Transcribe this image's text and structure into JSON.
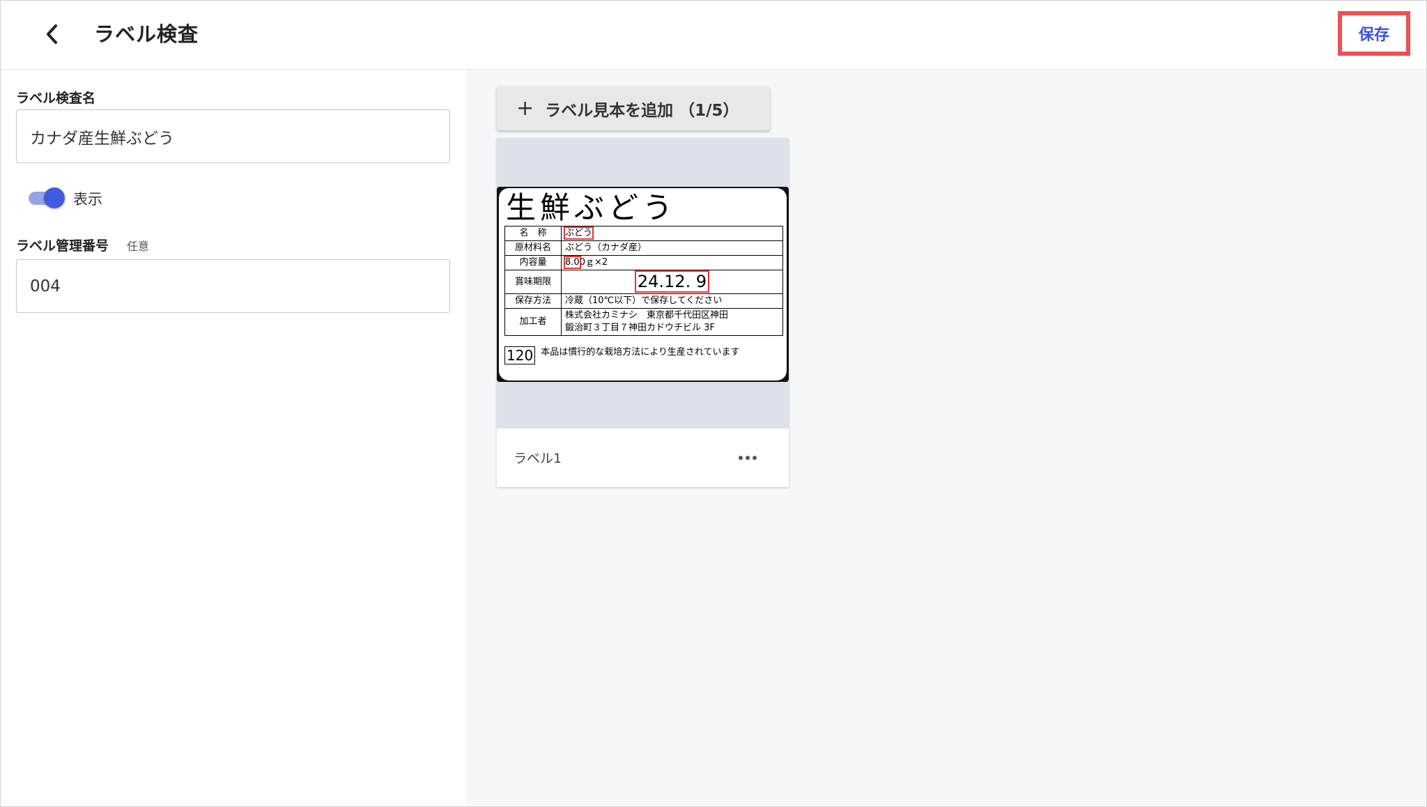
{
  "header": {
    "title": "ラベル検査",
    "save_label": "保存"
  },
  "form": {
    "name_label": "ラベル検査名",
    "name_value": "カナダ産生鮮ぶどう",
    "display_toggle_label": "表示",
    "display_toggle_on": true,
    "number_label": "ラベル管理番号",
    "number_optional": "任意",
    "number_value": "004"
  },
  "samples": {
    "add_button_label": "ラベル見本を追加 （1/5）",
    "cards": [
      {
        "name": "ラベル1",
        "label_image": {
          "heading": "生鮮ぶどう",
          "rows": [
            {
              "key": "名　称",
              "value": "ぶどう"
            },
            {
              "key": "原材料名",
              "value": "ぶどう（カナダ産）"
            },
            {
              "key": "内容量",
              "value_highlight": "8.0",
              "value_rest": "0ｇ×2"
            },
            {
              "key": "賞味期限",
              "value": "24.12. 9"
            },
            {
              "key": "保存方法",
              "value": "冷蔵（10℃以下）で保存してください"
            },
            {
              "key": "加工者",
              "value_line1": "株式会社カミナシ　東京都千代田区神田",
              "value_line2": "鍛治町３丁目７神田カドウチビル 3F"
            }
          ],
          "weight": "120",
          "footer_note": "本品は慣行的な栽培方法により生産されています"
        }
      }
    ]
  },
  "colors": {
    "accent": "#3853d8",
    "toggle_on": "#3f5ce0",
    "highlight_box": "#ef5050"
  },
  "icons": {
    "back": "chevron-left-icon",
    "add": "plus-icon",
    "more": "more-horizontal-icon"
  }
}
